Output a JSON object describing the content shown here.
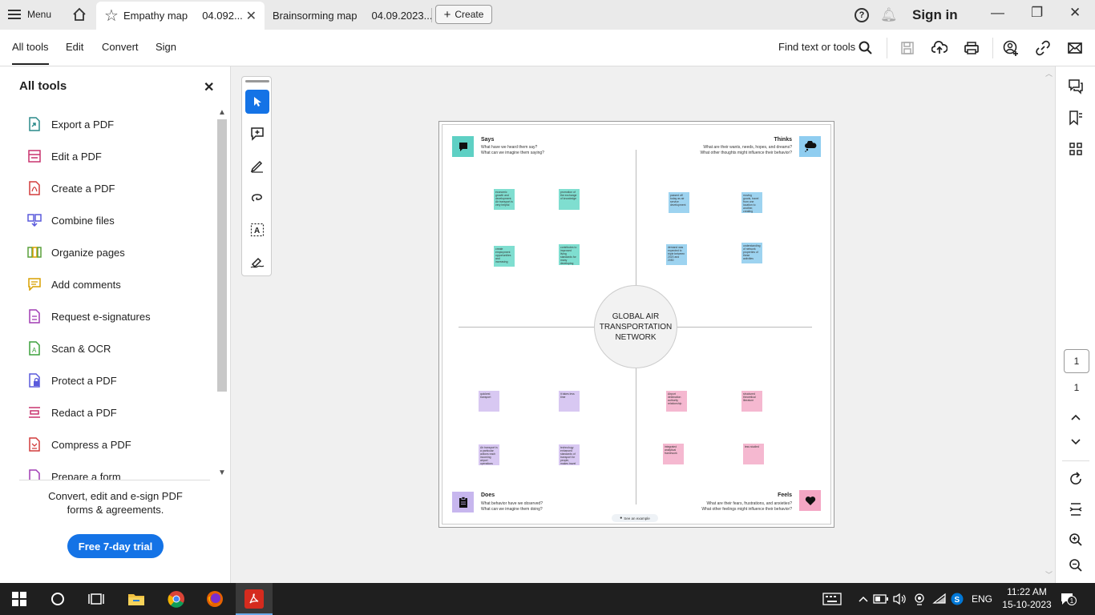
{
  "tabbar": {
    "menu_label": "Menu",
    "active_tab": "Empathy map     04.092...",
    "tab2": "Brainsorming map     04.09.2023...",
    "create_label": "Create",
    "signin_label": "Sign in"
  },
  "toolbar": {
    "tabs": [
      "All tools",
      "Edit",
      "Convert",
      "Sign"
    ],
    "find_label": "Find text or tools"
  },
  "leftpanel": {
    "title": "All tools",
    "items": [
      {
        "label": "Export a PDF",
        "color": "#2a8a8a"
      },
      {
        "label": "Edit a PDF",
        "color": "#c8326e"
      },
      {
        "label": "Create a PDF",
        "color": "#d23c3c"
      },
      {
        "label": "Combine files",
        "color": "#5a5adc"
      },
      {
        "label": "Organize pages",
        "color": "#5aa03c"
      },
      {
        "label": "Add comments",
        "color": "#d8a000"
      },
      {
        "label": "Request e-signatures",
        "color": "#a03cb4"
      },
      {
        "label": "Scan & OCR",
        "color": "#3ca03c"
      },
      {
        "label": "Protect a PDF",
        "color": "#5a5adc"
      },
      {
        "label": "Redact a PDF",
        "color": "#c8326e"
      },
      {
        "label": "Compress a PDF",
        "color": "#d23c3c"
      },
      {
        "label": "Prepare a form",
        "color": "#a03cb4"
      }
    ],
    "promo": "Convert, edit and e-sign PDF forms & agreements.",
    "trial_label": "Free 7-day trial"
  },
  "page": {
    "center": "GLOBAL AIR TRANSPORTATION NETWORK",
    "says": {
      "title": "Says",
      "q1": "What have we heard them say?",
      "q2": "What can we imagine them saying?"
    },
    "thinks": {
      "title": "Thinks",
      "q1": "What are their wants, needs, hopes, and dreams?",
      "q2": "What other thoughts might influence their behavior?"
    },
    "does": {
      "title": "Does",
      "q1": "What behavior have we observed?",
      "q2": "What can we imagine them doing?"
    },
    "feels": {
      "title": "Feels",
      "q1": "What are their fears, frustrations, and anxieties?",
      "q2": "What other feelings might influence their behavior?"
    },
    "notes": {
      "teal1": "economic growth and development. Air transport is very helpful",
      "teal2": "promotion of the exchange of knowledge",
      "teal3": "create employment opportunities and increasing",
      "teal4": "contributes to improved living standards for many developing",
      "blue1": "passed off today as air service development",
      "blue2": "moving goods, travel from one location to another, creating infrastructure, efficient timings",
      "blue3": "demand was expected to triple between 2020 and 2050",
      "blue4": "understanding of network properties of these activities",
      "violet1": "quickest transport",
      "violet2": "it takes less time",
      "violet3": "Air transport is a particular actions each incoming airport operations",
      "violet4": "technology enhanced standards of transport for people, makes travel a lot easier",
      "pink1": "Airport destination authority relationship",
      "pink2": "structured theoretical literature",
      "pink3": "integrated analytical framework",
      "pink4": "less studied"
    },
    "see_example": "See an example"
  },
  "rightrail": {
    "page_current": "1",
    "page_total": "1"
  },
  "taskbar": {
    "lang": "ENG",
    "time": "11:22 AM",
    "date": "15-10-2023",
    "notif_count": "1"
  },
  "colors": {
    "accent": "#1473e6",
    "says": "#5ed0c4",
    "thinks": "#8fcdf0",
    "does": "#c7b6ee",
    "feels": "#f4a6c4"
  }
}
